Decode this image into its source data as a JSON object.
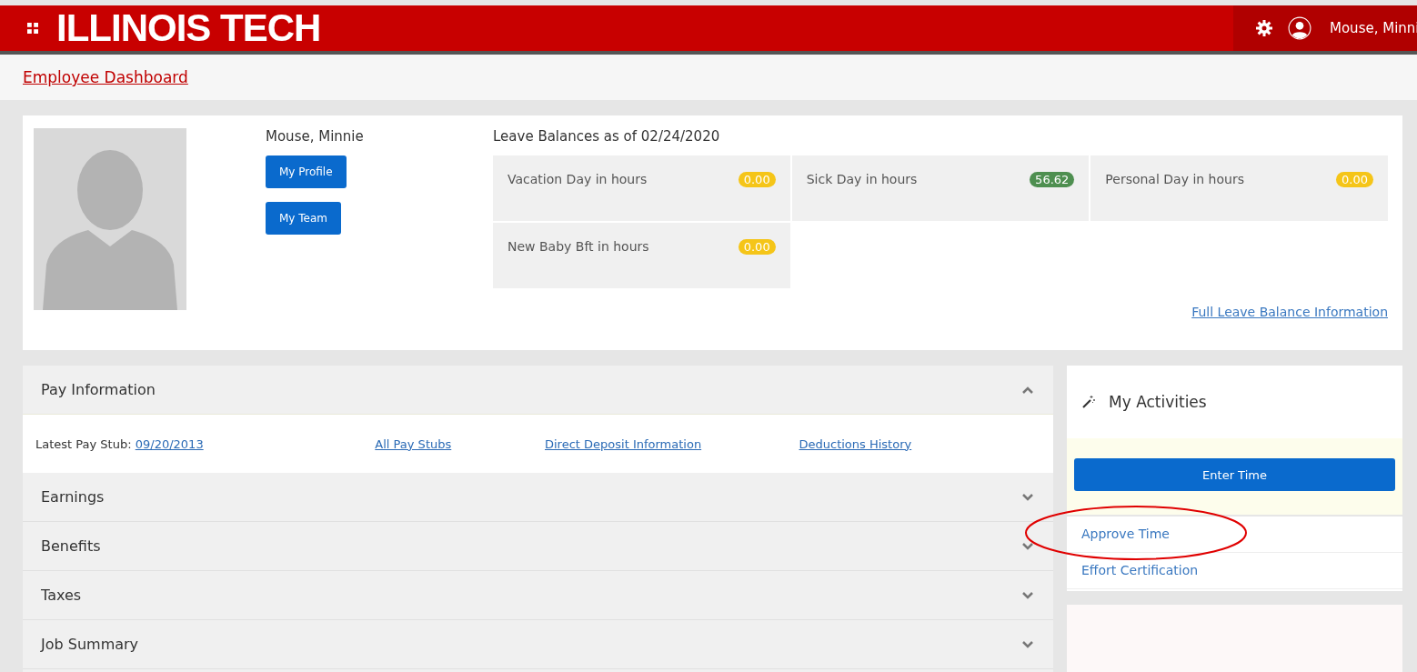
{
  "header": {
    "logo": "ILLINOIS TECH",
    "user_name": "Mouse, Minni"
  },
  "breadcrumb": {
    "label": "Employee Dashboard"
  },
  "profile": {
    "name": "Mouse, Minnie",
    "buttons": [
      "My Profile",
      "My Team"
    ]
  },
  "leave_balances": {
    "title": "Leave Balances as of 02/24/2020",
    "items": [
      {
        "label": "Vacation Day in hours",
        "value": "0.00",
        "color": "#f5c518"
      },
      {
        "label": "Sick Day in hours",
        "value": "56.62",
        "color": "#4e8f50"
      },
      {
        "label": "Personal Day in hours",
        "value": "0.00",
        "color": "#f5c518"
      },
      {
        "label": "New Baby Bft in hours",
        "value": "0.00",
        "color": "#f5c518"
      }
    ],
    "link": "Full Leave Balance Information"
  },
  "sections": [
    {
      "title": "Pay Information",
      "expanded": true,
      "stub_label": "Latest Pay Stub:",
      "stub_date": "09/20/2013",
      "links": [
        "All Pay Stubs",
        "Direct Deposit Information",
        "Deductions History"
      ]
    },
    {
      "title": "Earnings",
      "expanded": false
    },
    {
      "title": "Benefits",
      "expanded": false
    },
    {
      "title": "Taxes",
      "expanded": false
    },
    {
      "title": "Job Summary",
      "expanded": false
    }
  ],
  "activities": {
    "title": "My Activities",
    "primary": "Enter Time",
    "links": [
      "Approve Time",
      "Effort Certification"
    ]
  }
}
